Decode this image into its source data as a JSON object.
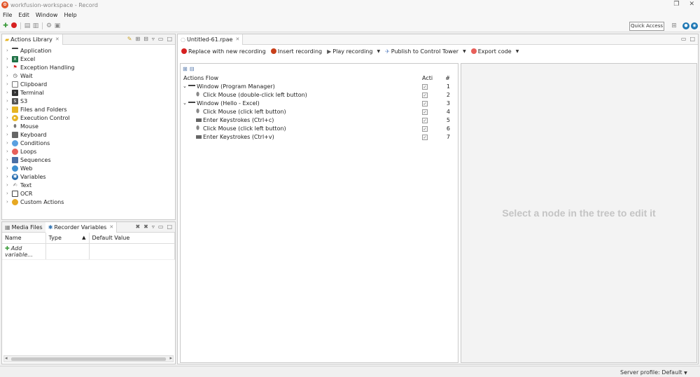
{
  "window": {
    "title": "workfusion-workspace - Record",
    "logo": "workfusion-logo"
  },
  "menu": [
    "File",
    "Edit",
    "Window",
    "Help"
  ],
  "toolbar": {
    "quick_access": "Quick Access"
  },
  "actions_library": {
    "tab": "Actions Library",
    "items": [
      "Application",
      "Excel",
      "Exception Handling",
      "Wait",
      "Clipboard",
      "Terminal",
      "S3",
      "Files and Folders",
      "Execution Control",
      "Mouse",
      "Keyboard",
      "Conditions",
      "Loops",
      "Sequences",
      "Web",
      "Variables",
      "Text",
      "OCR",
      "Custom Actions"
    ]
  },
  "bottom_panel": {
    "tabs": [
      "Media Files",
      "Recorder Variables"
    ],
    "columns": [
      "Name",
      "Type",
      "Default Value"
    ],
    "add_row": "Add variable..."
  },
  "editor": {
    "tab": "Untitled-61.rpae",
    "toolbar": {
      "replace": "Replace with new recording",
      "insert": "Insert recording",
      "play": "Play recording",
      "publish": "Publish to Control Tower",
      "export": "Export code"
    },
    "flow": {
      "header": "Actions Flow",
      "col_acti": "Acti",
      "col_num": "#",
      "rows": [
        {
          "label": "Window (Program Manager)",
          "num": "1"
        },
        {
          "label": "Click Mouse (double-click left button)",
          "num": "2"
        },
        {
          "label": "Window (Hello - Excel)",
          "num": "3"
        },
        {
          "label": "Click Mouse (click left button)",
          "num": "4"
        },
        {
          "label": "Enter Keystrokes (Ctrl+c)",
          "num": "5"
        },
        {
          "label": "Click Mouse (click left button)",
          "num": "6"
        },
        {
          "label": "Enter Keystrokes (Ctrl+v)",
          "num": "7"
        }
      ]
    },
    "detail_placeholder": "Select a node in the tree to edit it"
  },
  "status": {
    "server_profile": "Server profile: Default"
  }
}
